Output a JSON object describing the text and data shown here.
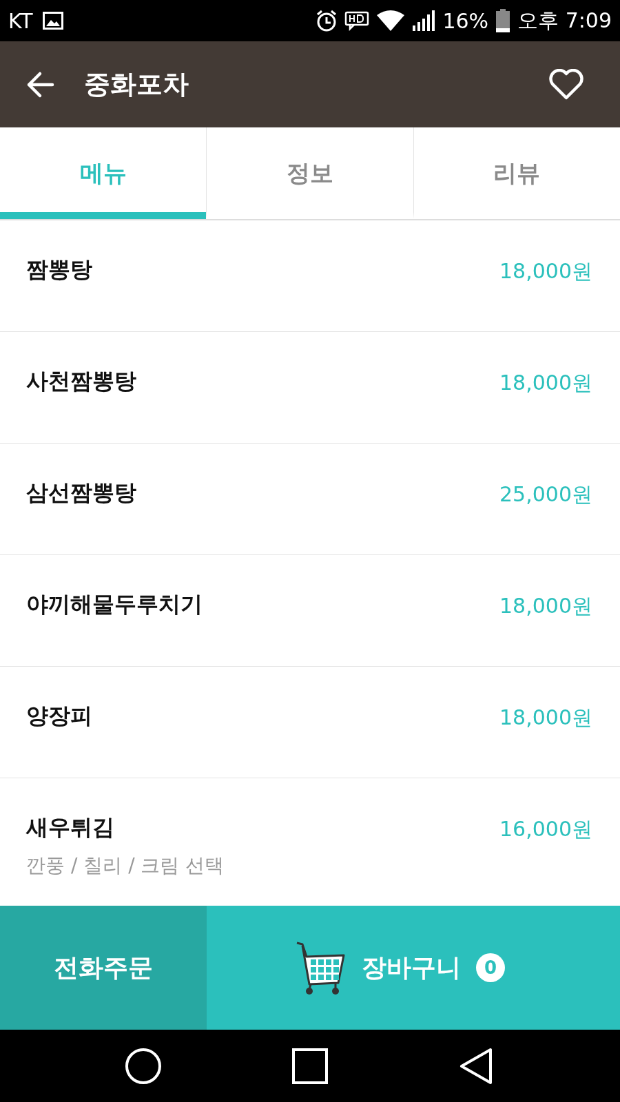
{
  "status_bar": {
    "carrier": "KT",
    "battery": "16%",
    "time": "오후 7:09"
  },
  "header": {
    "title": "중화포차",
    "favorite": false
  },
  "tabs": [
    {
      "label": "메뉴",
      "selected": true
    },
    {
      "label": "정보",
      "selected": false
    },
    {
      "label": "리뷰",
      "selected": false
    }
  ],
  "menu_items": [
    {
      "name": "짬뽕탕",
      "price": "18,000원"
    },
    {
      "name": "사천짬뽕탕",
      "price": "18,000원"
    },
    {
      "name": "삼선짬뽕탕",
      "price": "25,000원"
    },
    {
      "name": "야끼해물두루치기",
      "price": "18,000원"
    },
    {
      "name": "양장피",
      "price": "18,000원"
    },
    {
      "name": "새우튀김",
      "price": "16,000원",
      "note": "깐풍 / 칠리 / 크림 선택"
    }
  ],
  "bottom_bar": {
    "phone_order": "전화주문",
    "cart": "장바구니",
    "cart_count": "0"
  }
}
